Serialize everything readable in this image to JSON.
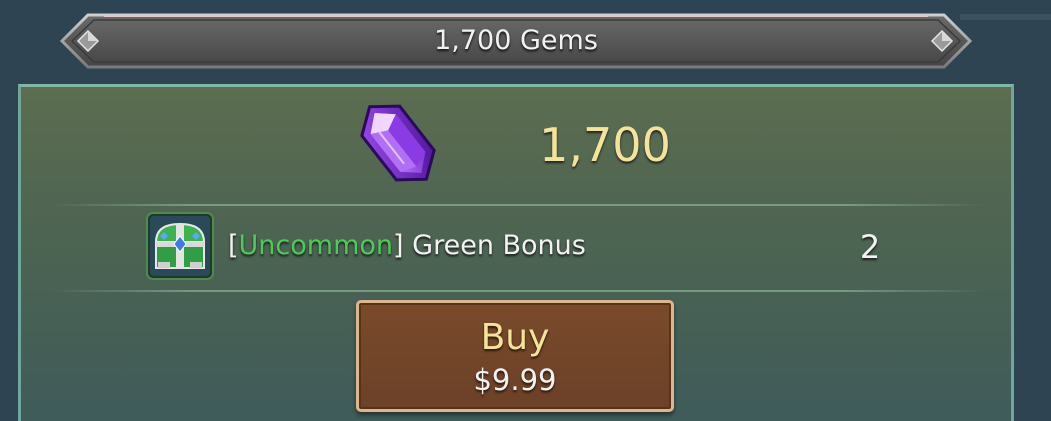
{
  "banner": {
    "title": "1,700 Gems"
  },
  "offer": {
    "gem_icon": "purple-gem-icon",
    "gem_amount": "1,700",
    "bonus": {
      "icon": "treasure-chest-icon",
      "open_bracket": "[",
      "rarity": "Uncommon",
      "close_bracket": "]",
      "name": " Green Bonus",
      "quantity": "2"
    }
  },
  "buy_button": {
    "label": "Buy",
    "price": "$9.99"
  },
  "colors": {
    "rarity_uncommon": "#4dcb58",
    "amount_gold": "#f5e39a",
    "button_brown": "#6b4128"
  }
}
